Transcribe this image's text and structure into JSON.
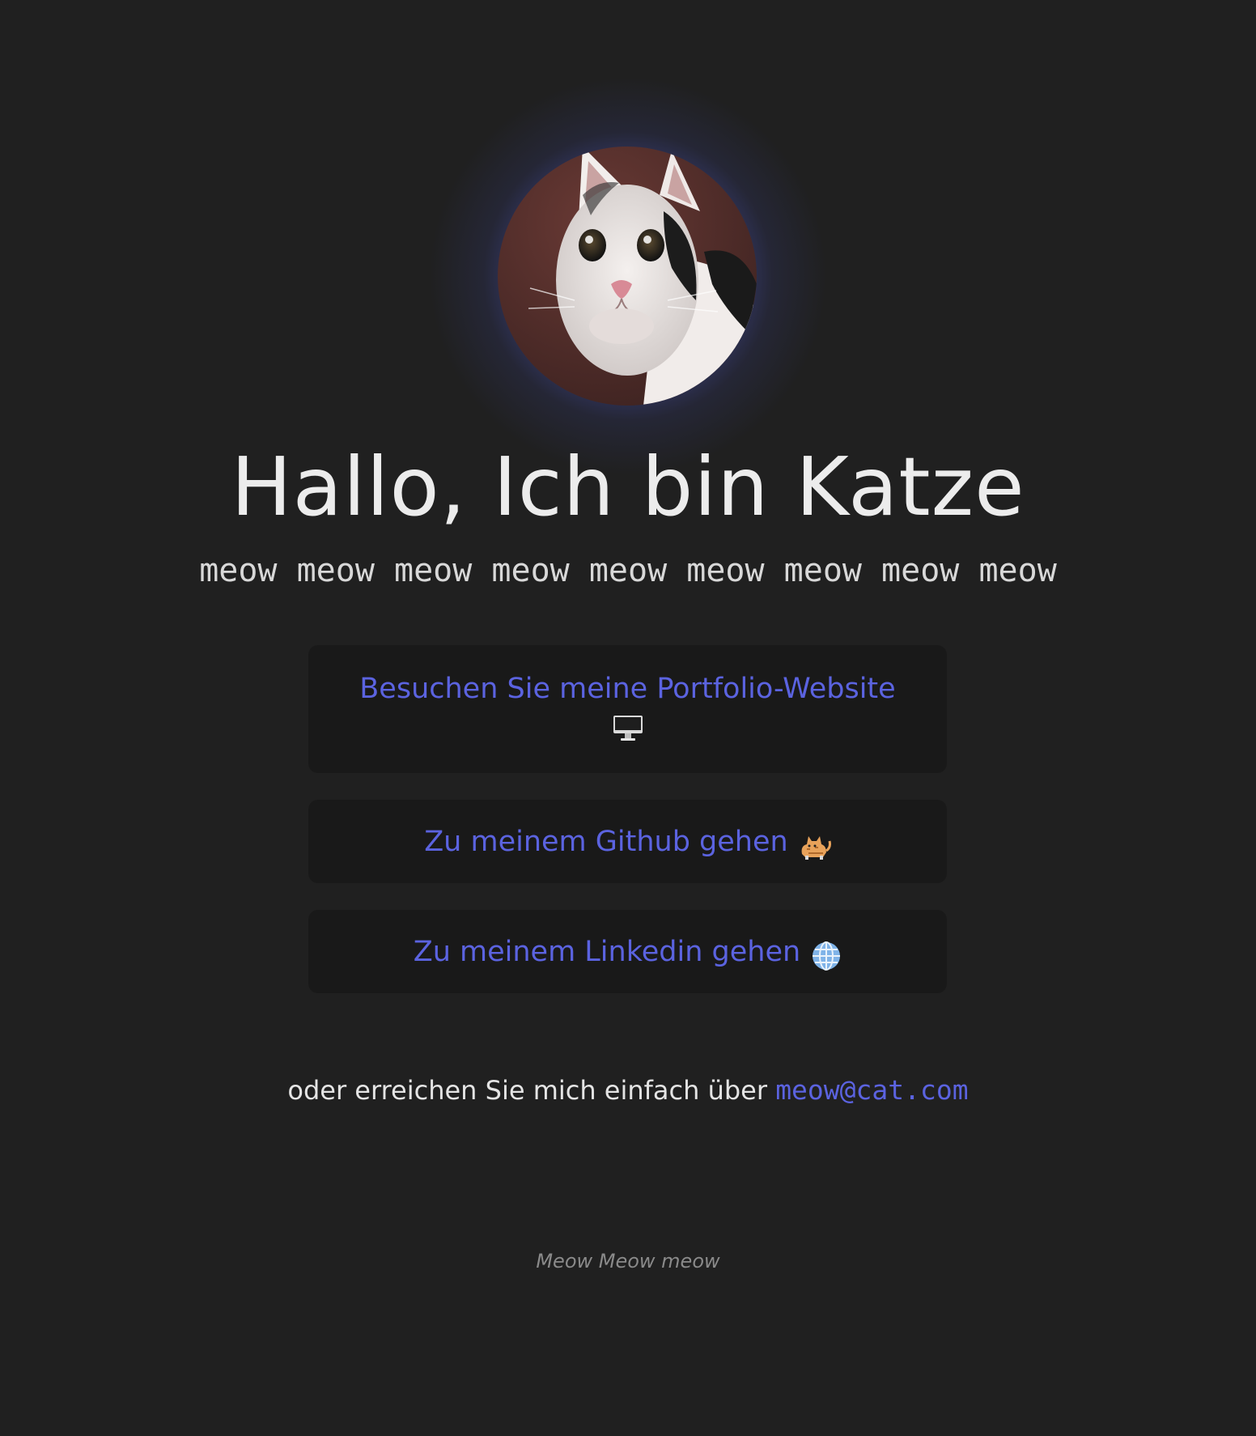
{
  "profile": {
    "avatar_alt": "cat-avatar",
    "title": "Hallo, Ich bin Katze",
    "subtitle": "meow meow meow meow meow meow meow meow meow"
  },
  "links": {
    "portfolio": {
      "label": "Besuchen Sie meine Portfolio-Website",
      "icon": "desktop-computer-icon"
    },
    "github": {
      "label": "Zu meinem Github gehen",
      "icon": "cat-icon"
    },
    "linkedin": {
      "label": "Zu meinem Linkedin gehen",
      "icon": "globe-icon"
    }
  },
  "contact": {
    "prefix": "oder erreichen Sie mich einfach über",
    "email": "meow@cat.com"
  },
  "footer": {
    "text": "Meow Meow meow"
  },
  "colors": {
    "background": "#202020",
    "card": "#191919",
    "accent": "#5b63e0",
    "glow": "#525cc8",
    "text": "#ececec",
    "muted": "#8a8a8a"
  }
}
